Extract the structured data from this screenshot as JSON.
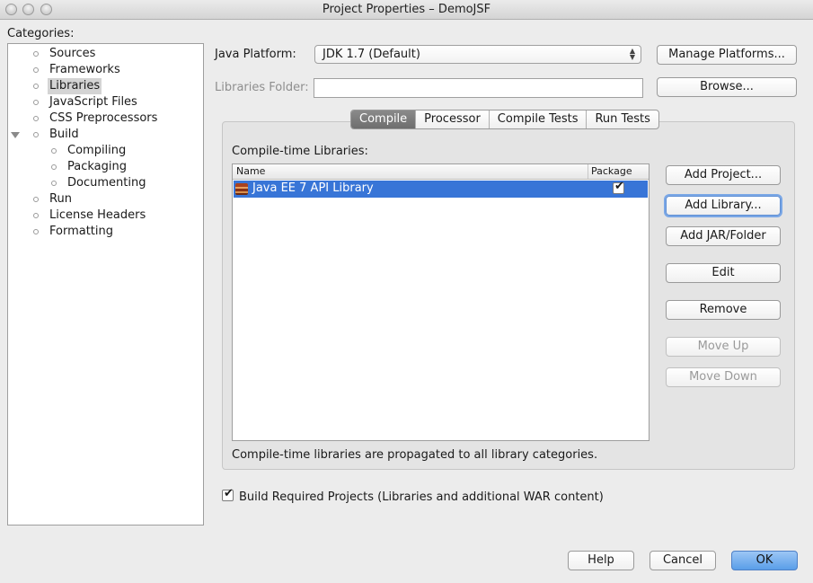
{
  "window": {
    "title": "Project Properties – DemoJSF"
  },
  "categories": {
    "label": "Categories:",
    "items": [
      {
        "label": "Sources"
      },
      {
        "label": "Frameworks"
      },
      {
        "label": "Libraries",
        "selected": true
      },
      {
        "label": "JavaScript Files"
      },
      {
        "label": "CSS Preprocessors"
      },
      {
        "label": "Build",
        "expanded": true
      },
      {
        "label": "Compiling"
      },
      {
        "label": "Packaging"
      },
      {
        "label": "Documenting"
      },
      {
        "label": "Run"
      },
      {
        "label": "License Headers"
      },
      {
        "label": "Formatting"
      }
    ]
  },
  "java_platform": {
    "label": "Java Platform:",
    "value": "JDK 1.7 (Default)",
    "manage_button": "Manage Platforms..."
  },
  "libraries_folder": {
    "label": "Libraries Folder:",
    "value": "",
    "browse_button": "Browse..."
  },
  "tabs": [
    {
      "label": "Compile",
      "active": true
    },
    {
      "label": "Processor"
    },
    {
      "label": "Compile Tests"
    },
    {
      "label": "Run Tests"
    }
  ],
  "compile": {
    "label": "Compile-time Libraries:",
    "columns": {
      "name": "Name",
      "package": "Package"
    },
    "rows": [
      {
        "name": "Java EE 7 API Library",
        "package": true
      }
    ],
    "note": "Compile-time libraries are propagated to all library categories.",
    "buttons": {
      "add_project": "Add Project...",
      "add_library": "Add Library...",
      "add_jar": "Add JAR/Folder",
      "edit": "Edit",
      "remove": "Remove",
      "move_up": "Move Up",
      "move_down": "Move Down"
    }
  },
  "build_required": {
    "label": "Build Required Projects (Libraries and additional WAR content)",
    "checked": true
  },
  "footer": {
    "help": "Help",
    "cancel": "Cancel",
    "ok": "OK"
  },
  "colors": {
    "selection": "#3875d7",
    "accent_button": "#5a9ee8"
  }
}
